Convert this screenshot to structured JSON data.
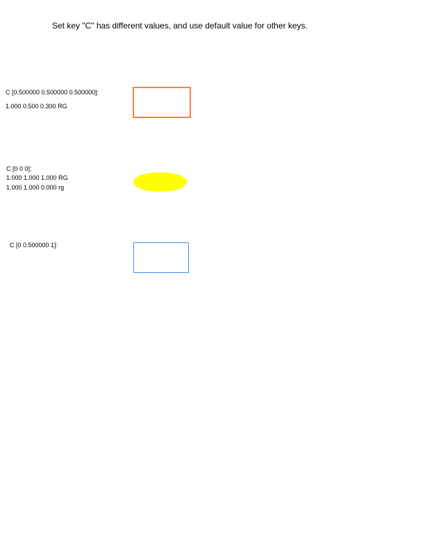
{
  "page": {
    "title": "Set key \"C\" has different values, and use default value for other keys."
  },
  "annotations": [
    {
      "lines": [
        "C [0.500000 0.500000 0.500000]:",
        "1.000 0.500 0.300 RG"
      ],
      "shape": "rectangle",
      "stroke_color": "#fa8247"
    },
    {
      "lines": [
        "C [0 0 0]:",
        "1.000 1.000 1.000 RG",
        "1.000 1.000 0.000 rg"
      ],
      "shape": "ellipse",
      "fill_color": "#ffff00"
    },
    {
      "lines": [
        "C [0 0.500000 1]:"
      ],
      "shape": "rectangle",
      "stroke_color": "#3f8fe9"
    }
  ]
}
